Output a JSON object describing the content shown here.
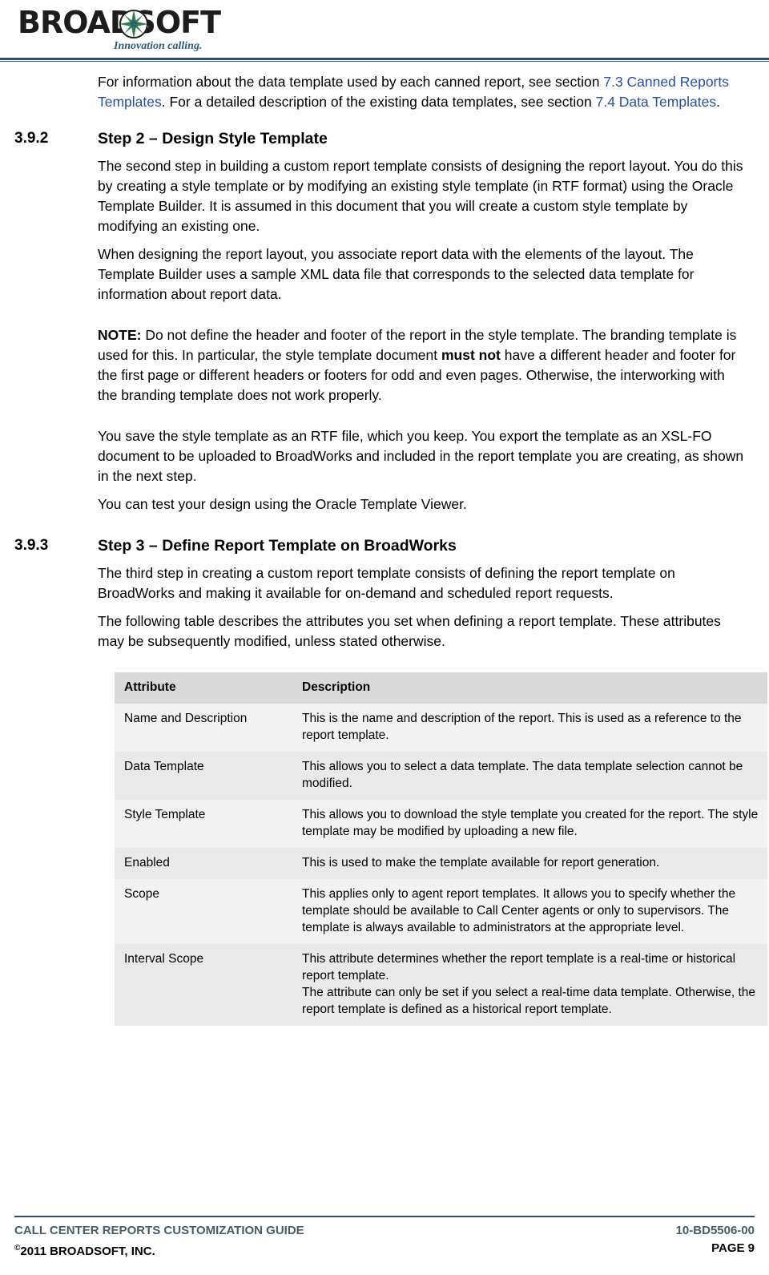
{
  "header": {
    "logo_main": "BROAD",
    "logo_soft": "SOFT",
    "logo_tagline": "Innovation calling.",
    "logo_icon": "star-burst-icon"
  },
  "intro": {
    "part1": "For information about the data template used by each canned report, see section ",
    "link1": "7.3 Canned Reports Templates",
    "part2": ".  For a detailed description of the existing data templates, see section ",
    "link2": "7.4 Data Templates",
    "part3": "."
  },
  "sections": [
    {
      "number": "3.9.2",
      "title": "Step 2 – Design Style Template",
      "paragraphs": [
        "The second step in building a custom report template consists of designing the report layout.  You do this by creating a style template or by modifying an existing style template (in RTF format) using the Oracle Template Builder.  It is assumed in this document that you will create a custom style template by modifying an existing one.",
        "When designing the report layout, you associate report data with the elements of the layout.  The Template Builder uses a sample XML data file that corresponds to the selected data template for information about report data."
      ]
    }
  ],
  "note": {
    "label": "NOTE:",
    "text_1": "  Do not define the header and footer of the report in the style template.  The branding template is used for this.  In particular, the style template document ",
    "bold_1": "must not",
    "text_2": " have a different header and footer for the first page or different headers or footers for odd and even pages.  Otherwise, the interworking with the branding template does not work properly."
  },
  "after_note": [
    "You save the style template as an RTF file, which you keep.  You export the template as an XSL-FO document to be uploaded to BroadWorks and included in the report template you are creating, as shown in the next step.",
    "You can test your design using the Oracle Template Viewer."
  ],
  "section3": {
    "number": "3.9.3",
    "title": "Step 3 – Define Report Template on BroadWorks",
    "paragraphs": [
      "The third step in creating a custom report template consists of defining the report template on BroadWorks and making it available for on-demand and scheduled report requests.",
      "The following table describes the attributes you set when defining a report template.  These attributes may be subsequently modified, unless stated otherwise."
    ]
  },
  "table": {
    "headers": [
      "Attribute",
      "Description"
    ],
    "rows": [
      {
        "attribute": "Name and Description",
        "description": "This is the name and description of the report.  This is used as a reference to the report template."
      },
      {
        "attribute": "Data Template",
        "description": "This allows you to select a data template.  The data template selection cannot be modified."
      },
      {
        "attribute": "Style Template",
        "description": "This allows you to download the style template you created for the report.  The style template may be modified by uploading a new file."
      },
      {
        "attribute": "Enabled",
        "description": "This is used to make the template available for report generation."
      },
      {
        "attribute": "Scope",
        "description": "This applies only to agent report templates.  It allows you to specify whether the template should be available to Call Center agents or only to supervisors.  The template is always available to administrators at the appropriate level."
      },
      {
        "attribute": "Interval Scope",
        "description": "This attribute determines whether the report template is a real-time or historical report template.\nThe attribute can only be set if you select a real-time data template.  Otherwise, the report template is defined as a historical report template."
      }
    ]
  },
  "footer": {
    "left_top": "CALL CENTER REPORTS CUSTOMIZATION GUIDE",
    "right_top": "10-BD5506-00",
    "left_bottom": "2011 BROADSOFT, INC.",
    "left_bottom_mark": "©",
    "right_bottom": "PAGE 9"
  }
}
